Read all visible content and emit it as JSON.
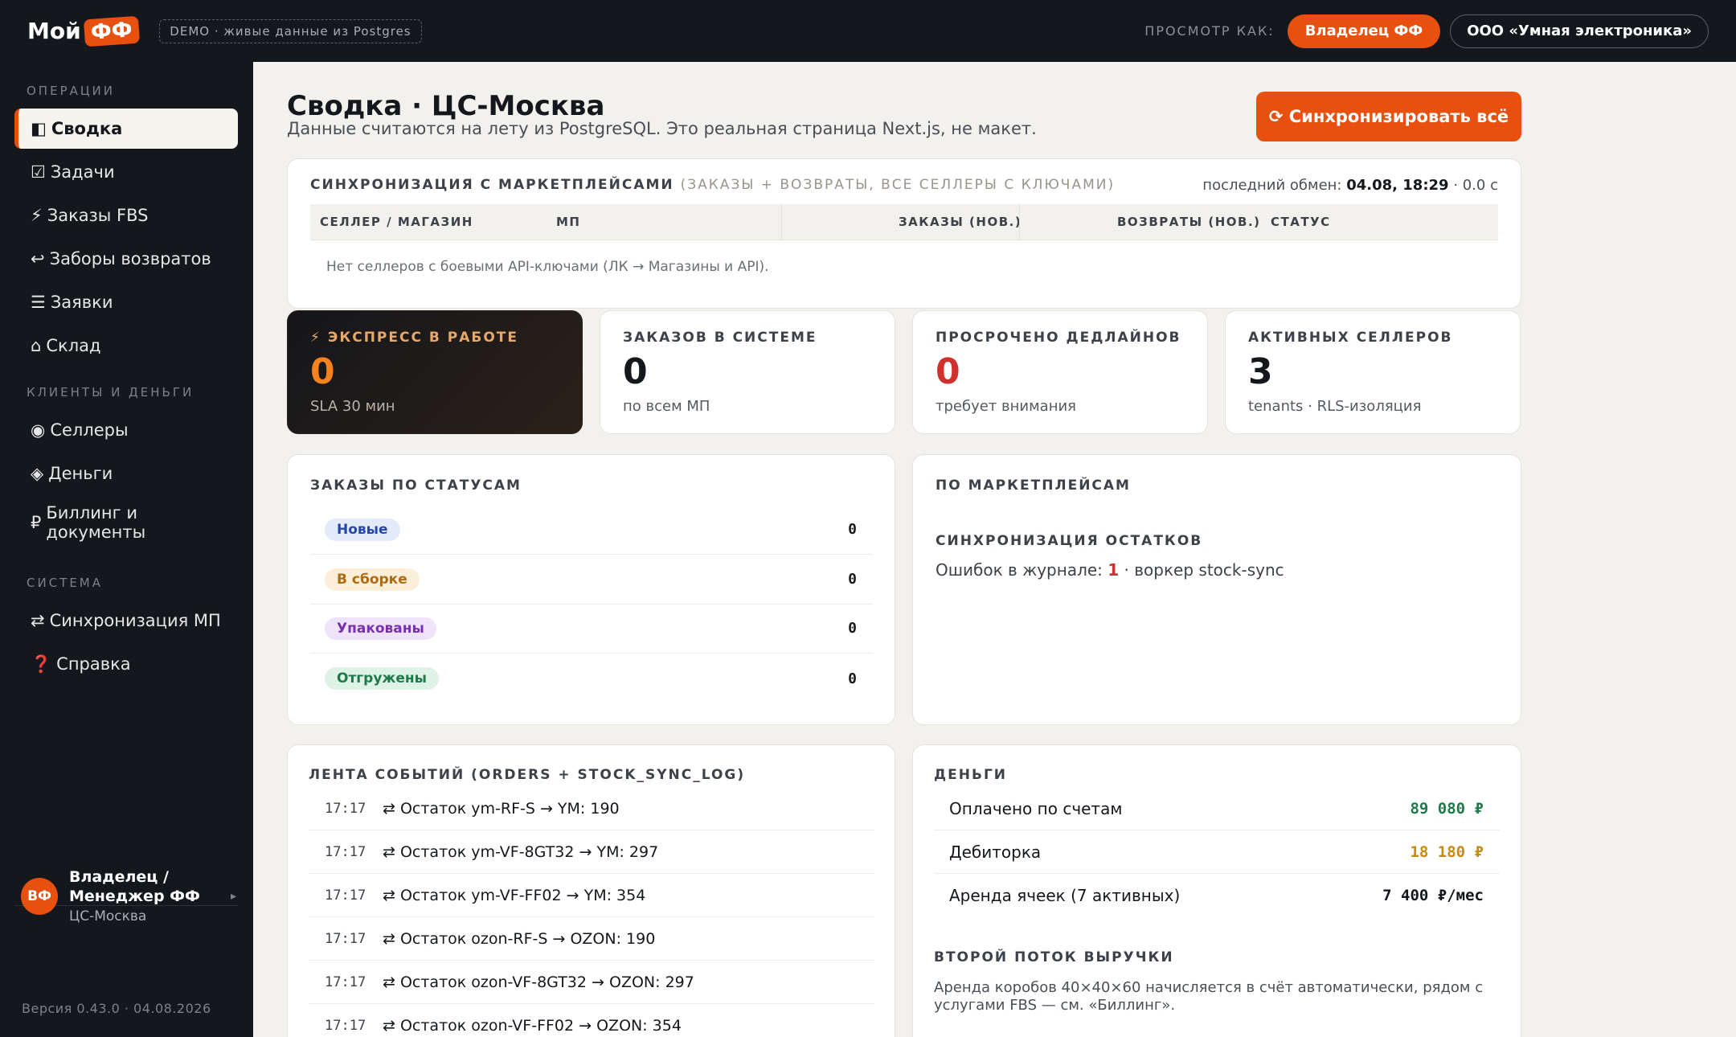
{
  "brand": {
    "prefix": "Мой",
    "badge": "ФФ"
  },
  "demo_badge": "DEMO · живые данные из Postgres",
  "topbar": {
    "view_as_label": "ПРОСМОТР КАК:",
    "role": "Владелец ФФ",
    "tenant": "ООО «Умная электроника»"
  },
  "sidebar": {
    "sections": [
      "ОПЕРАЦИИ",
      "КЛИЕНТЫ И ДЕНЬГИ",
      "СИСТЕМА"
    ],
    "items": [
      {
        "icon": "◧",
        "label": "Сводка"
      },
      {
        "icon": "☑",
        "label": "Задачи"
      },
      {
        "icon": "⚡",
        "label": "Заказы FBS"
      },
      {
        "icon": "↩",
        "label": "Заборы возвратов"
      },
      {
        "icon": "☰",
        "label": "Заявки"
      },
      {
        "icon": "⌂",
        "label": "Склад"
      },
      {
        "icon": "◉",
        "label": "Селлеры"
      },
      {
        "icon": "◈",
        "label": "Деньги"
      },
      {
        "icon": "₽",
        "label": "Биллинг и документы"
      },
      {
        "icon": "⇄",
        "label": "Синхронизация МП"
      },
      {
        "icon": "❓",
        "label": "Справка"
      }
    ],
    "user": {
      "initials": "ВФ",
      "name": "Владелец / Менеджер ФФ",
      "location": "ЦС-Москва"
    },
    "version": "Версия 0.43.0 · 04.08.2026"
  },
  "page": {
    "title": "Сводка · ЦС-Москва",
    "subtitle": "Данные считаются на лету из PostgreSQL. Это реальная страница Next.js, не макет.",
    "sync_all_button": "⟳ Синхронизировать всё"
  },
  "sync": {
    "title": "СИНХРОНИЗАЦИЯ С МАРКЕТПЛЕЙСАМИ",
    "title_note": "(ЗАКАЗЫ + ВОЗВРАТЫ, ВСЕ СЕЛЛЕРЫ С КЛЮЧАМИ)",
    "meta_prefix": "последний обмен:",
    "meta_time": "04.08, 18:29",
    "meta_suffix": "· 0.0 с",
    "columns": [
      "СЕЛЛЕР / МАГАЗИН",
      "МП",
      "ЗАКАЗЫ (НОВ.)",
      "ВОЗВРАТЫ (НОВ.)",
      "СТАТУС"
    ],
    "empty": "Нет селлеров с боевыми API-ключами (ЛК → Магазины и API)."
  },
  "stats": [
    {
      "label": "⚡ ЭКСПРЕСС В РАБОТЕ",
      "value": "0",
      "note": "SLA 30 мин"
    },
    {
      "label": "ЗАКАЗОВ В СИСТЕМЕ",
      "value": "0",
      "note": "по всем МП"
    },
    {
      "label": "ПРОСРОЧЕНО ДЕДЛАЙНОВ",
      "value": "0",
      "note": "требует внимания"
    },
    {
      "label": "АКТИВНЫХ СЕЛЛЕРОВ",
      "value": "3",
      "note": "tenants · RLS-изоляция"
    }
  ],
  "orders_by_status": {
    "title": "ЗАКАЗЫ ПО СТАТУСАМ",
    "rows": [
      {
        "label": "Новые",
        "count": "0",
        "color": "#2447a8",
        "bg": "#e3ebfb"
      },
      {
        "label": "В сборке",
        "count": "0",
        "color": "#b06a10",
        "bg": "#fcefd9"
      },
      {
        "label": "Упакованы",
        "count": "0",
        "color": "#7a2fb0",
        "bg": "#efe3fa"
      },
      {
        "label": "Отгружены",
        "count": "0",
        "color": "#1f7a4a",
        "bg": "#def2e6"
      }
    ]
  },
  "marketplaces": {
    "title": "ПО МАРКЕТПЛЕЙСАМ",
    "stock_title": "СИНХРОНИЗАЦИЯ ОСТАТКОВ",
    "errors_prefix": "Ошибок в журнале:",
    "errors_count": "1",
    "errors_suffix": "· воркер stock-sync"
  },
  "events": {
    "title": "ЛЕНТА СОБЫТИЙ (ORDERS + STOCK_SYNC_LOG)",
    "rows": [
      {
        "time": "17:17",
        "text": "⇄ Остаток ym-RF-S → YM: 190"
      },
      {
        "time": "17:17",
        "text": "⇄ Остаток ym-VF-8GT32 → YM: 297"
      },
      {
        "time": "17:17",
        "text": "⇄ Остаток ym-VF-FF02 → YM: 354"
      },
      {
        "time": "17:17",
        "text": "⇄ Остаток ozon-RF-S → OZON: 190"
      },
      {
        "time": "17:17",
        "text": "⇄ Остаток ozon-VF-8GT32 → OZON: 297"
      },
      {
        "time": "17:17",
        "text": "⇄ Остаток ozon-VF-FF02 → OZON: 354"
      }
    ]
  },
  "money": {
    "title": "ДЕНЬГИ",
    "rows": [
      {
        "label": "Оплачено по счетам",
        "value": "89 080 ₽",
        "color": "#1f7a4a"
      },
      {
        "label": "Дебиторка",
        "value": "18 180 ₽",
        "color": "#c98a12"
      },
      {
        "label": "Аренда ячеек (7 активных)",
        "value": "7 400 ₽/мес",
        "color": "#14171c"
      }
    ],
    "second_title": "ВТОРОЙ ПОТОК ВЫРУЧКИ",
    "second_desc": "Аренда коробов 40×40×60 начисляется в счёт автоматически, рядом с услугами FBS — см. «Биллинг»."
  },
  "colors": {
    "accent": "#e8500f",
    "sidebar_bg": "#14171c",
    "page_bg": "#f2f1ee",
    "danger": "#d0312d"
  }
}
